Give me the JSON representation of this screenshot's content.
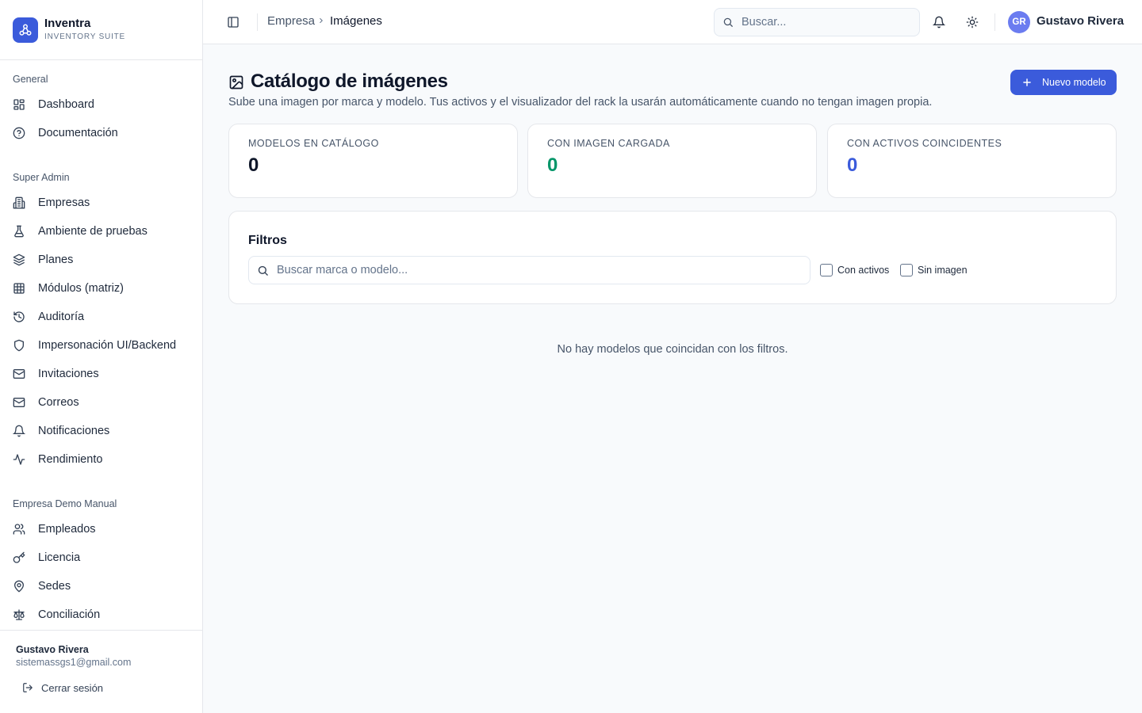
{
  "brand": {
    "name": "Inventra",
    "subtitle": "INVENTORY SUITE",
    "logo_icon": "network-icon"
  },
  "sidebar": {
    "sections": [
      {
        "title": "General",
        "items": [
          {
            "label": "Dashboard",
            "icon": "grid-icon"
          },
          {
            "label": "Documentación",
            "icon": "help-circle-icon"
          }
        ]
      },
      {
        "title": "Super Admin",
        "items": [
          {
            "label": "Empresas",
            "icon": "building-icon"
          },
          {
            "label": "Ambiente de pruebas",
            "icon": "flask-icon"
          },
          {
            "label": "Planes",
            "icon": "layers-icon"
          },
          {
            "label": "Módulos (matriz)",
            "icon": "table-icon"
          },
          {
            "label": "Auditoría",
            "icon": "history-icon"
          },
          {
            "label": "Impersonación UI/Backend",
            "icon": "shield-icon"
          },
          {
            "label": "Invitaciones",
            "icon": "mail-icon"
          },
          {
            "label": "Correos",
            "icon": "mail-icon"
          },
          {
            "label": "Notificaciones",
            "icon": "bell-icon"
          },
          {
            "label": "Rendimiento",
            "icon": "activity-icon"
          }
        ]
      },
      {
        "title": "Empresa Demo Manual",
        "items": [
          {
            "label": "Empleados",
            "icon": "users-icon"
          },
          {
            "label": "Licencia",
            "icon": "key-icon"
          },
          {
            "label": "Sedes",
            "icon": "map-pin-icon"
          },
          {
            "label": "Conciliación",
            "icon": "scale-icon"
          }
        ]
      }
    ],
    "footer": {
      "name": "Gustavo Rivera",
      "email": "sistemassgs1@gmail.com",
      "logout_label": "Cerrar sesión"
    }
  },
  "header": {
    "breadcrumb": [
      "Empresa",
      "Imágenes"
    ],
    "search_placeholder": "Buscar...",
    "user": {
      "initials": "GR",
      "name": "Gustavo Rivera"
    }
  },
  "main": {
    "title": "Catálogo de imágenes",
    "subtitle": "Sube una imagen por marca y modelo. Tus activos y el visualizador del rack la usarán automáticamente cuando no tengan imagen propia.",
    "new_button_label": "Nuevo modelo",
    "stats": [
      {
        "label": "Modelos en catálogo",
        "value": "0",
        "color": "#0f172a"
      },
      {
        "label": "Con imagen cargada",
        "value": "0",
        "color": "#059669"
      },
      {
        "label": "Con activos coincidentes",
        "value": "0",
        "color": "#3b5bdb"
      }
    ],
    "filters": {
      "title": "Filtros",
      "search_placeholder": "Buscar marca o modelo...",
      "with_assets_label": "Con activos",
      "without_image_label": "Sin imagen"
    },
    "empty_message": "No hay modelos que coincidan con los filtros."
  },
  "colors": {
    "accent": "#3b5bdb",
    "success": "#059669",
    "border": "#e5e7eb",
    "background": "#f8fafc"
  }
}
